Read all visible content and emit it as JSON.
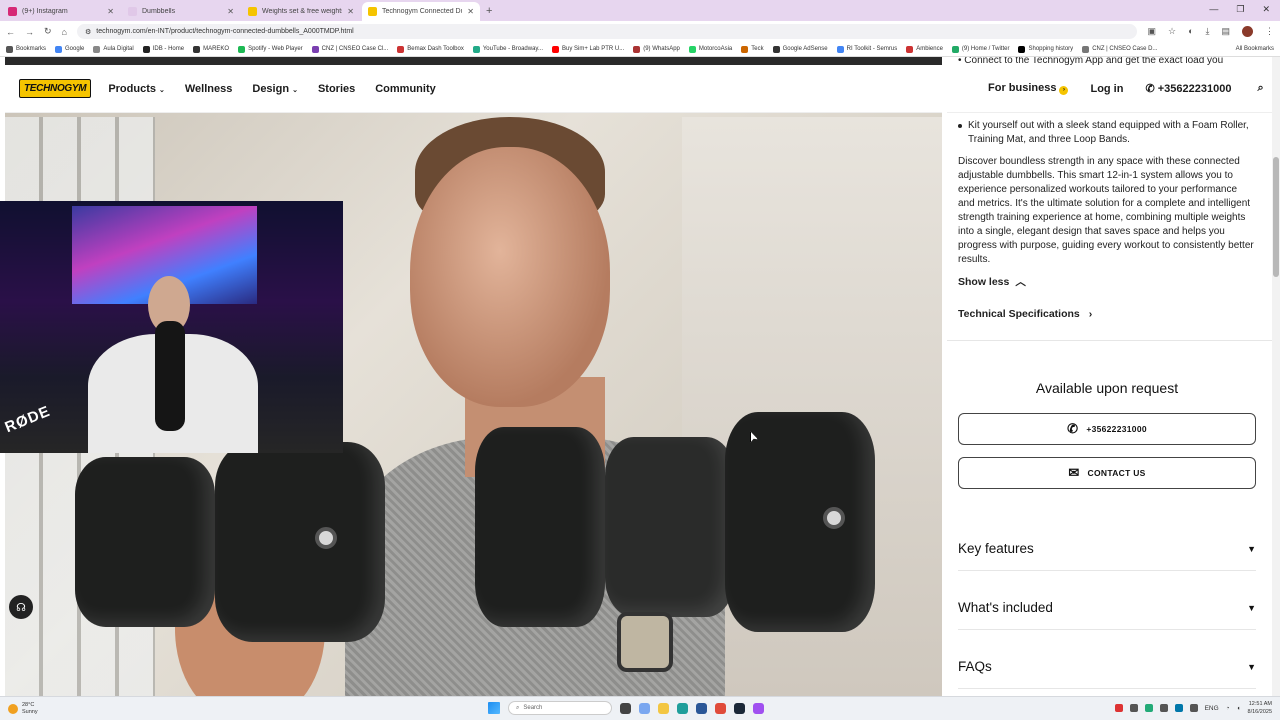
{
  "browser": {
    "tabs": [
      {
        "title": "(9+) Instagram",
        "color": "#d62976",
        "active": false
      },
      {
        "title": "Dumbbells",
        "color": "#e0c8e8",
        "active": false
      },
      {
        "title": "Weights set & free weights ste",
        "color": "#f5c400",
        "active": false
      },
      {
        "title": "Technogym Connected Dumbb",
        "color": "#f5c400",
        "active": true
      }
    ],
    "url": "technogym.com/en-INT/product/technogym-connected-dumbbells_A000TMDP.html",
    "bookmarks": [
      "Bookmarks",
      "Google",
      "Aula Digital",
      "IDB - Home",
      "MAREKO",
      "Spotify - Web Player",
      "CNZ | CNSEO Case Cl...",
      "Bemax Dash Toolbox",
      "YouTube - Broadway...",
      "Buy Sim+ Lab PTR U...",
      "(9) WhatsApp",
      "MotorcoAsia",
      "Teck",
      "Google AdSense",
      "RI Toolkit - Semrus",
      "Ambience",
      "(9) Home / Twitter",
      "Shopping history",
      "CNZ | CNSEO Case D..."
    ],
    "all_bookmarks": "All Bookmarks"
  },
  "site": {
    "logo": "TECHNOGYM",
    "nav": [
      {
        "label": "Products",
        "has_dropdown": true
      },
      {
        "label": "Wellness",
        "has_dropdown": false
      },
      {
        "label": "Design",
        "has_dropdown": true
      },
      {
        "label": "Stories",
        "has_dropdown": false
      },
      {
        "label": "Community",
        "has_dropdown": false
      }
    ],
    "for_business": "For business",
    "login": "Log in",
    "phone": "+35622231000"
  },
  "webcam": {
    "brand_text": "RØDE"
  },
  "panel": {
    "top_bullet": "Connect to the Technogym App and get the exact load you",
    "bullet": "Kit yourself out with a sleek stand equipped with a Foam Roller, Training Mat, and three Loop Bands.",
    "description": "Discover boundless strength in any space with these connected adjustable dumbbells. This smart 12-in-1 system allows you to experience personalized workouts tailored to your performance and metrics. It's the ultimate solution for a complete and intelligent strength training experience at home, combining multiple weights into a single, elegant design that saves space and helps you progress with purpose, guiding every workout to consistently better results.",
    "show_less": "Show less",
    "tech_spec": "Technical Specifications",
    "available": "Available upon request",
    "cta_phone": "+35622231000",
    "cta_contact": "CONTACT US",
    "accordions": [
      "Key features",
      "What's included",
      "FAQs"
    ]
  },
  "taskbar": {
    "weather_temp": "28°C",
    "weather_desc": "Sunny",
    "search": "Search",
    "lang": "ENG",
    "time": "12:51 AM",
    "date": "8/16/2025"
  },
  "colors": {
    "brand_yellow": "#f5c400",
    "tabbar": "#e7d6ef"
  }
}
